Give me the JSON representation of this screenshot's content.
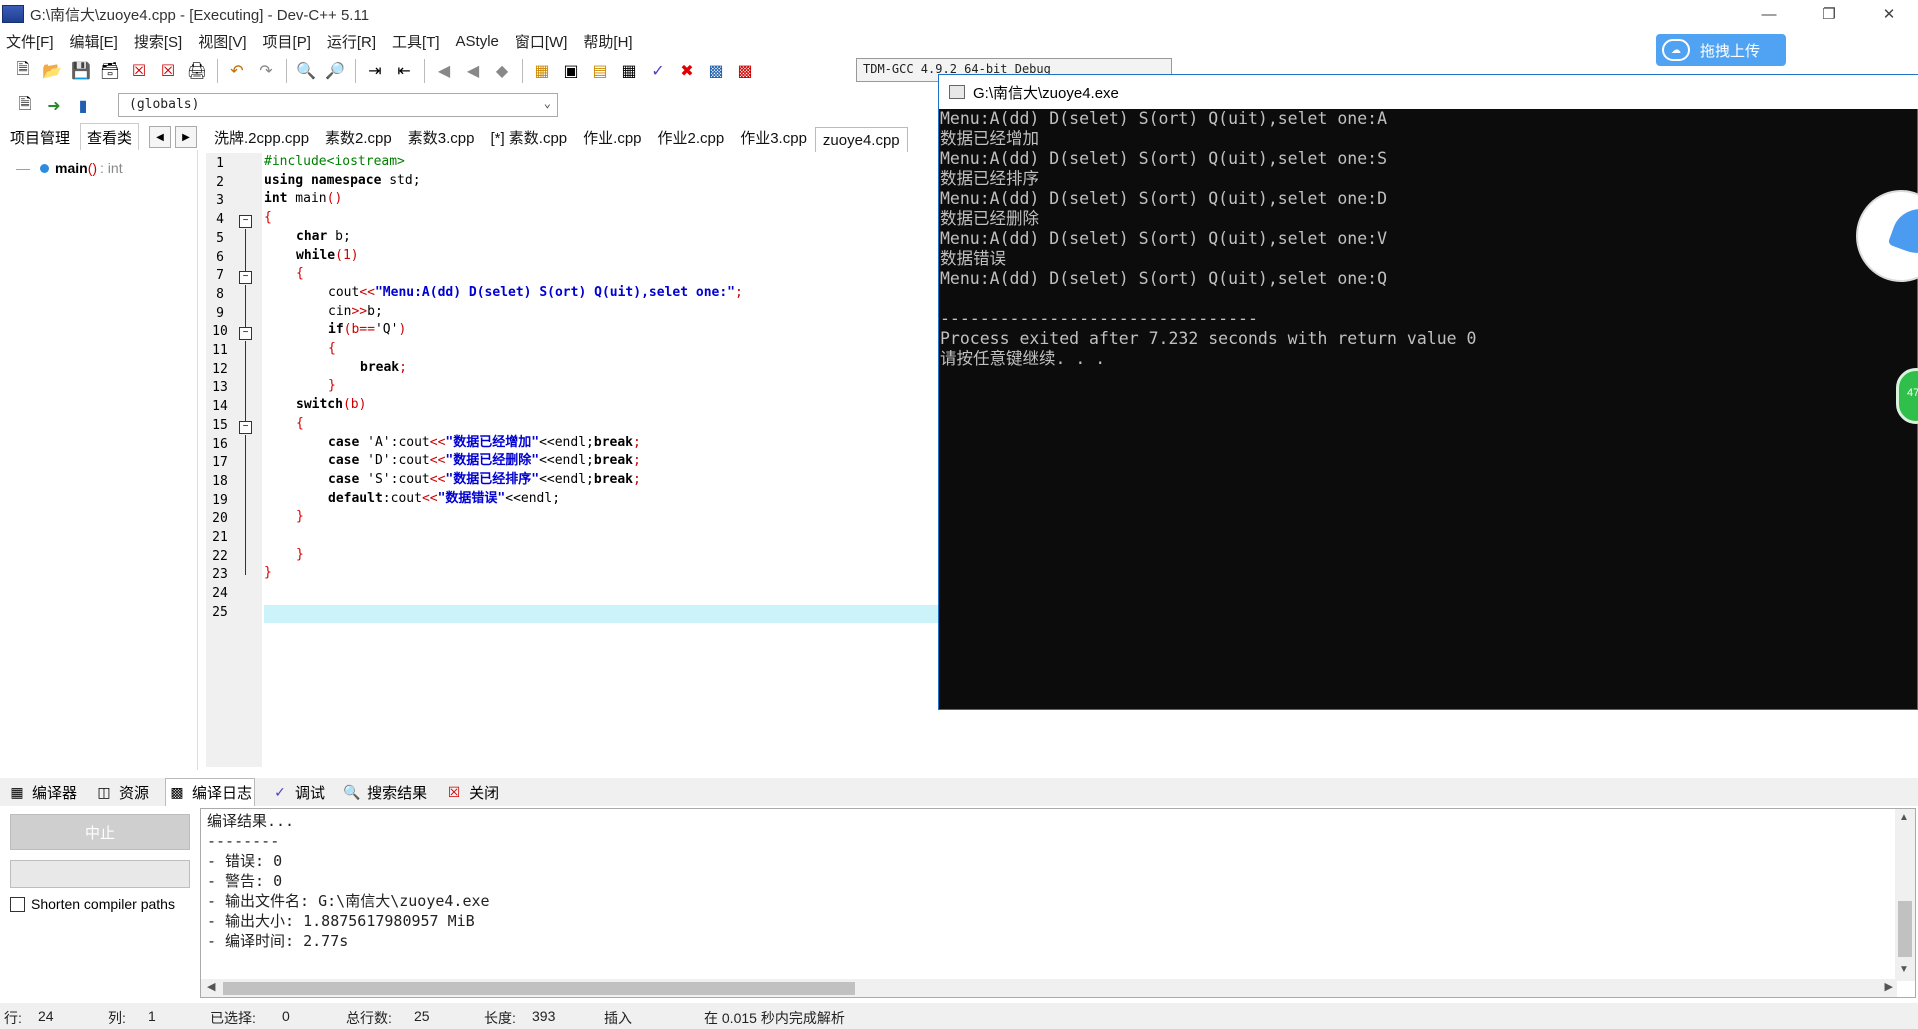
{
  "window": {
    "title": "G:\\南信大\\zuoye4.cpp - [Executing] - Dev-C++ 5.11"
  },
  "menu": [
    "文件[F]",
    "编辑[E]",
    "搜索[S]",
    "视图[V]",
    "项目[P]",
    "运行[R]",
    "工具[T]",
    "AStyle",
    "窗口[W]",
    "帮助[H]"
  ],
  "upload": {
    "label": "拖拽上传"
  },
  "toolbar": {
    "compiler": "TDM-GCC 4.9.2 64-bit Debug"
  },
  "scope": {
    "value": "(globals)"
  },
  "left_tabs": [
    "项目管理",
    "查看类"
  ],
  "class_tree": {
    "item": "main",
    "paren": "()",
    "type": ": int"
  },
  "editor_tabs": [
    "洗牌.2cpp.cpp",
    "素数2.cpp",
    "素数3.cpp",
    "[*] 素数.cpp",
    "作业.cpp",
    "作业2.cpp",
    "作业3.cpp",
    "zuoye4.cpp"
  ],
  "line_numbers": [
    "1",
    "2",
    "3",
    "4",
    "5",
    "6",
    "7",
    "8",
    "9",
    "10",
    "11",
    "12",
    "13",
    "14",
    "15",
    "16",
    "17",
    "18",
    "19",
    "20",
    "21",
    "22",
    "23",
    "24",
    "25"
  ],
  "code": {
    "l1": "#include<iostream>",
    "l2a": "using namespace",
    "l2b": " std;",
    "l3a": "int",
    "l3b": " main",
    "l3c": "()",
    "l4": "{",
    "l5a": "char",
    "l5b": " b;",
    "l6a": "while",
    "l6b": "(1)",
    "l7": "{",
    "l8a": "cout",
    "l8b": "<<",
    "l8c": "\"Menu:A(dd) D(selet) S(ort) Q(uit),selet one:\"",
    "l8d": ";",
    "l9a": "cin",
    "l9b": ">>",
    "l9c": "b;",
    "l10a": "if",
    "l10b": "(b==",
    "l10c": "'Q'",
    "l10d": ")",
    "l11": "{",
    "l12a": "break",
    "l12b": ";",
    "l13": "}",
    "l14a": "switch",
    "l14b": "(b)",
    "l15": "{",
    "l16a": "case",
    "l16b": " 'A'",
    "l16c": ":cout",
    "l16d": "<<",
    "l16e": "\"数据已经增加\"",
    "l16f": "<<endl;",
    "l16g": "break",
    "l16h": ";",
    "l17a": "case",
    "l17b": " 'D'",
    "l17c": ":cout",
    "l17d": "<<",
    "l17e": "\"数据已经删除\"",
    "l17f": "<<endl;",
    "l17g": "break",
    "l17h": ";",
    "l18a": "case",
    "l18b": " 'S'",
    "l18c": ":cout",
    "l18d": "<<",
    "l18e": "\"数据已经排序\"",
    "l18f": "<<endl;",
    "l18g": "break",
    "l18h": ";",
    "l19a": "default",
    "l19b": ":cout",
    "l19c": "<<",
    "l19d": "\"数据错误\"",
    "l19e": "<<endl;",
    "l20": "}",
    "l22": "}",
    "l23": "}"
  },
  "console": {
    "title": "G:\\南信大\\zuoye4.exe",
    "lines": [
      "Menu:A(dd) D(selet) S(ort) Q(uit),selet one:A",
      "数据已经增加",
      "Menu:A(dd) D(selet) S(ort) Q(uit),selet one:S",
      "数据已经排序",
      "Menu:A(dd) D(selet) S(ort) Q(uit),selet one:D",
      "数据已经删除",
      "Menu:A(dd) D(selet) S(ort) Q(uit),selet one:V",
      "数据错误",
      "Menu:A(dd) D(selet) S(ort) Q(uit),selet one:Q",
      "",
      "--------------------------------",
      "Process exited after 7.232 seconds with return value 0",
      "请按任意键继续. . ."
    ]
  },
  "bubble": {
    "green_label": "47"
  },
  "bottom_tabs": [
    "编译器",
    "资源",
    "编译日志",
    "调试",
    "搜索结果",
    "关闭"
  ],
  "build": {
    "stop_label": "中止",
    "shorten_label": "Shorten compiler paths"
  },
  "log": [
    "编译结果...",
    "--------",
    "- 错误: 0",
    "- 警告: 0",
    "- 输出文件名: G:\\南信大\\zuoye4.exe",
    "- 输出大小: 1.8875617980957 MiB",
    "- 编译时间: 2.77s"
  ],
  "status": {
    "row_label": "行:",
    "row": "24",
    "col_label": "列:",
    "col": "1",
    "sel_label": "已选择:",
    "sel": "0",
    "total_label": "总行数:",
    "total": "25",
    "len_label": "长度:",
    "len": "393",
    "mode": "插入",
    "parse": "在 0.015 秒内完成解析"
  }
}
